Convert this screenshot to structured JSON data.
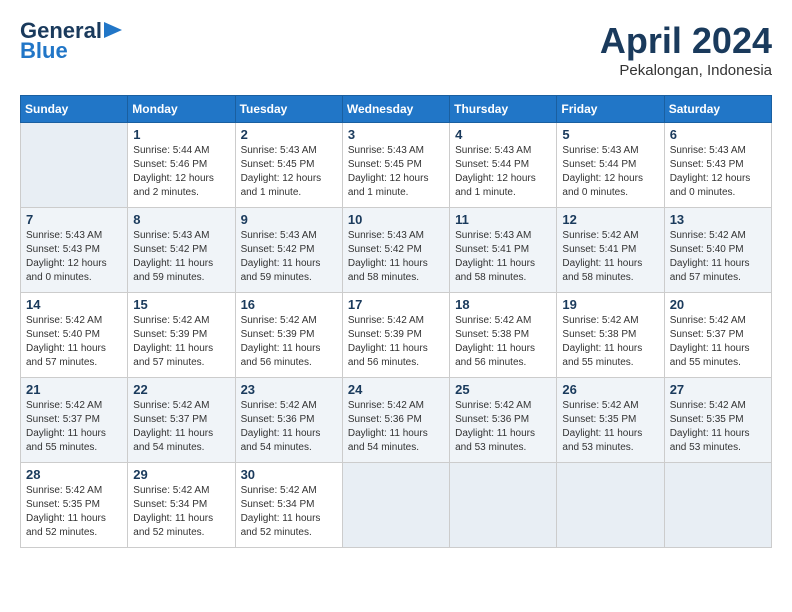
{
  "logo": {
    "line1": "General",
    "line2": "Blue",
    "arrow": true
  },
  "header": {
    "month": "April 2024",
    "location": "Pekalongan, Indonesia"
  },
  "weekdays": [
    "Sunday",
    "Monday",
    "Tuesday",
    "Wednesday",
    "Thursday",
    "Friday",
    "Saturday"
  ],
  "weeks": [
    [
      {
        "day": "",
        "info": ""
      },
      {
        "day": "1",
        "info": "Sunrise: 5:44 AM\nSunset: 5:46 PM\nDaylight: 12 hours\nand 2 minutes."
      },
      {
        "day": "2",
        "info": "Sunrise: 5:43 AM\nSunset: 5:45 PM\nDaylight: 12 hours\nand 1 minute."
      },
      {
        "day": "3",
        "info": "Sunrise: 5:43 AM\nSunset: 5:45 PM\nDaylight: 12 hours\nand 1 minute."
      },
      {
        "day": "4",
        "info": "Sunrise: 5:43 AM\nSunset: 5:44 PM\nDaylight: 12 hours\nand 1 minute."
      },
      {
        "day": "5",
        "info": "Sunrise: 5:43 AM\nSunset: 5:44 PM\nDaylight: 12 hours\nand 0 minutes."
      },
      {
        "day": "6",
        "info": "Sunrise: 5:43 AM\nSunset: 5:43 PM\nDaylight: 12 hours\nand 0 minutes."
      }
    ],
    [
      {
        "day": "7",
        "info": "Sunrise: 5:43 AM\nSunset: 5:43 PM\nDaylight: 12 hours\nand 0 minutes."
      },
      {
        "day": "8",
        "info": "Sunrise: 5:43 AM\nSunset: 5:42 PM\nDaylight: 11 hours\nand 59 minutes."
      },
      {
        "day": "9",
        "info": "Sunrise: 5:43 AM\nSunset: 5:42 PM\nDaylight: 11 hours\nand 59 minutes."
      },
      {
        "day": "10",
        "info": "Sunrise: 5:43 AM\nSunset: 5:42 PM\nDaylight: 11 hours\nand 58 minutes."
      },
      {
        "day": "11",
        "info": "Sunrise: 5:43 AM\nSunset: 5:41 PM\nDaylight: 11 hours\nand 58 minutes."
      },
      {
        "day": "12",
        "info": "Sunrise: 5:42 AM\nSunset: 5:41 PM\nDaylight: 11 hours\nand 58 minutes."
      },
      {
        "day": "13",
        "info": "Sunrise: 5:42 AM\nSunset: 5:40 PM\nDaylight: 11 hours\nand 57 minutes."
      }
    ],
    [
      {
        "day": "14",
        "info": "Sunrise: 5:42 AM\nSunset: 5:40 PM\nDaylight: 11 hours\nand 57 minutes."
      },
      {
        "day": "15",
        "info": "Sunrise: 5:42 AM\nSunset: 5:39 PM\nDaylight: 11 hours\nand 57 minutes."
      },
      {
        "day": "16",
        "info": "Sunrise: 5:42 AM\nSunset: 5:39 PM\nDaylight: 11 hours\nand 56 minutes."
      },
      {
        "day": "17",
        "info": "Sunrise: 5:42 AM\nSunset: 5:39 PM\nDaylight: 11 hours\nand 56 minutes."
      },
      {
        "day": "18",
        "info": "Sunrise: 5:42 AM\nSunset: 5:38 PM\nDaylight: 11 hours\nand 56 minutes."
      },
      {
        "day": "19",
        "info": "Sunrise: 5:42 AM\nSunset: 5:38 PM\nDaylight: 11 hours\nand 55 minutes."
      },
      {
        "day": "20",
        "info": "Sunrise: 5:42 AM\nSunset: 5:37 PM\nDaylight: 11 hours\nand 55 minutes."
      }
    ],
    [
      {
        "day": "21",
        "info": "Sunrise: 5:42 AM\nSunset: 5:37 PM\nDaylight: 11 hours\nand 55 minutes."
      },
      {
        "day": "22",
        "info": "Sunrise: 5:42 AM\nSunset: 5:37 PM\nDaylight: 11 hours\nand 54 minutes."
      },
      {
        "day": "23",
        "info": "Sunrise: 5:42 AM\nSunset: 5:36 PM\nDaylight: 11 hours\nand 54 minutes."
      },
      {
        "day": "24",
        "info": "Sunrise: 5:42 AM\nSunset: 5:36 PM\nDaylight: 11 hours\nand 54 minutes."
      },
      {
        "day": "25",
        "info": "Sunrise: 5:42 AM\nSunset: 5:36 PM\nDaylight: 11 hours\nand 53 minutes."
      },
      {
        "day": "26",
        "info": "Sunrise: 5:42 AM\nSunset: 5:35 PM\nDaylight: 11 hours\nand 53 minutes."
      },
      {
        "day": "27",
        "info": "Sunrise: 5:42 AM\nSunset: 5:35 PM\nDaylight: 11 hours\nand 53 minutes."
      }
    ],
    [
      {
        "day": "28",
        "info": "Sunrise: 5:42 AM\nSunset: 5:35 PM\nDaylight: 11 hours\nand 52 minutes."
      },
      {
        "day": "29",
        "info": "Sunrise: 5:42 AM\nSunset: 5:34 PM\nDaylight: 11 hours\nand 52 minutes."
      },
      {
        "day": "30",
        "info": "Sunrise: 5:42 AM\nSunset: 5:34 PM\nDaylight: 11 hours\nand 52 minutes."
      },
      {
        "day": "",
        "info": ""
      },
      {
        "day": "",
        "info": ""
      },
      {
        "day": "",
        "info": ""
      },
      {
        "day": "",
        "info": ""
      }
    ]
  ]
}
